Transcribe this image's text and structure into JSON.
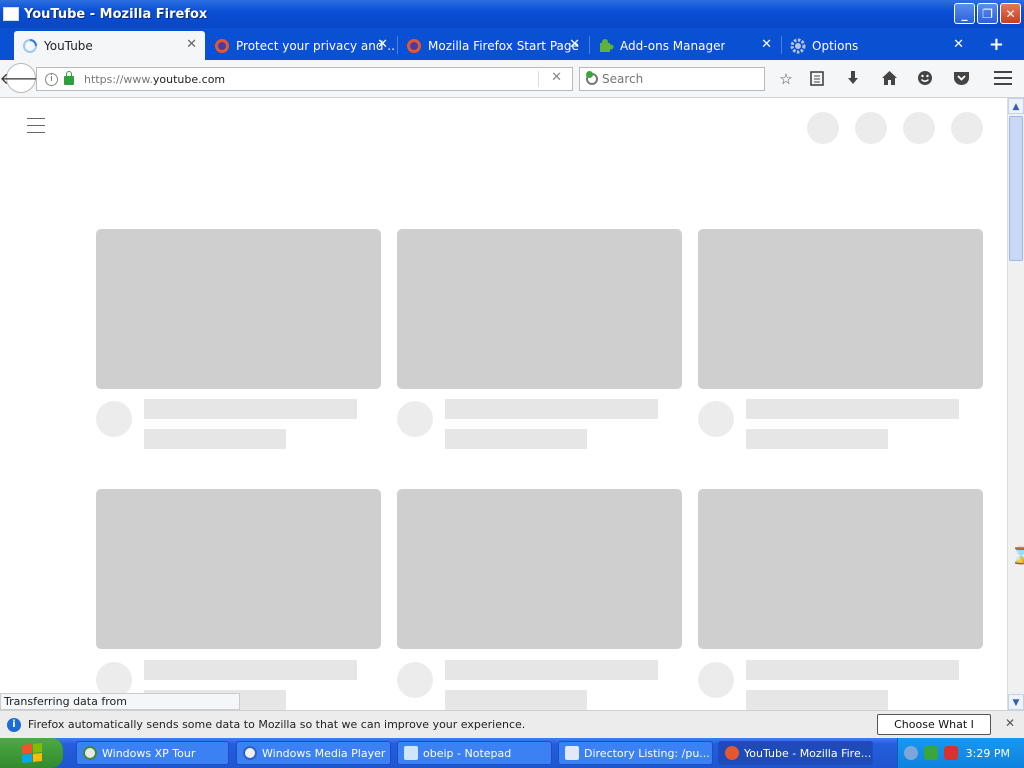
{
  "window": {
    "title": "YouTube - Mozilla Firefox"
  },
  "tabs": [
    {
      "label": "YouTube",
      "active": true
    },
    {
      "label": "Protect your privacy and ...",
      "active": false
    },
    {
      "label": "Mozilla Firefox Start Page",
      "active": false
    },
    {
      "label": "Add-ons Manager",
      "active": false
    },
    {
      "label": "Options",
      "active": false
    }
  ],
  "navbar": {
    "url_prefix": "https://www.",
    "url_host": "youtube.com",
    "search_placeholder": "Search"
  },
  "icons": {
    "back": "back-arrow-icon",
    "bookmark": "star-icon",
    "reading": "clipboard-icon",
    "downloads": "download-arrow-icon",
    "home": "home-icon",
    "hello": "smiley-icon",
    "pocket": "pocket-icon",
    "menu": "hamburger-icon"
  },
  "status": {
    "text": "Transferring data from www.youtube.com..."
  },
  "notification": {
    "message": "Firefox automatically sends some data to Mozilla so that we can improve your experience.",
    "button": "Choose What I Share"
  },
  "taskbar": {
    "items": [
      {
        "label": "Windows XP Tour",
        "active": false
      },
      {
        "label": "Windows Media Player",
        "active": false
      },
      {
        "label": "obeip - Notepad",
        "active": false
      },
      {
        "label": "Directory Listing: /pu...",
        "active": false
      },
      {
        "label": "YouTube - Mozilla Fire...",
        "active": true
      }
    ],
    "clock": "3:29 PM"
  },
  "colors": {
    "titlebar": "#0a50d2",
    "placeholder_thumb": "#cfcfcf",
    "placeholder_light": "#e6e6e6",
    "taskbar": "#245edb",
    "start": "#3a9a34"
  }
}
